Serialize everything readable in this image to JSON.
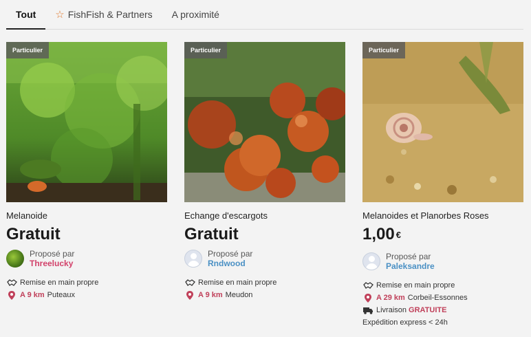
{
  "tabs": [
    {
      "label": "Tout",
      "active": true
    },
    {
      "label": "FishFish & Partners",
      "icon": "star-outline-icon"
    },
    {
      "label": "A proximité"
    }
  ],
  "colors": {
    "accent_pink": "#d2416a",
    "accent_blue": "#4a90c4",
    "star": "#e07a2f"
  },
  "listings": [
    {
      "badge": "Particulier",
      "title": "Melanoide",
      "price": "Gratuit",
      "seller_label": "Proposé par",
      "seller_name": "Threelucky",
      "handover": "Remise en main propre",
      "distance": "A 9 km",
      "city": "Puteaux"
    },
    {
      "badge": "Particulier",
      "title": "Echange d'escargots",
      "price": "Gratuit",
      "seller_label": "Proposé par",
      "seller_name": "Rndwood",
      "handover": "Remise en main propre",
      "distance": "A 9 km",
      "city": "Meudon"
    },
    {
      "badge": "Particulier",
      "title": "Melanoides et Planorbes Roses",
      "price": "1,00",
      "currency": "€",
      "seller_label": "Proposé par",
      "seller_name": "Paleksandre",
      "handover": "Remise en main propre",
      "distance": "A 29 km",
      "city": "Corbeil-Essonnes",
      "delivery_label": "Livraison",
      "delivery_value": "GRATUITE",
      "shipping": "Expédition express < 24h"
    }
  ]
}
